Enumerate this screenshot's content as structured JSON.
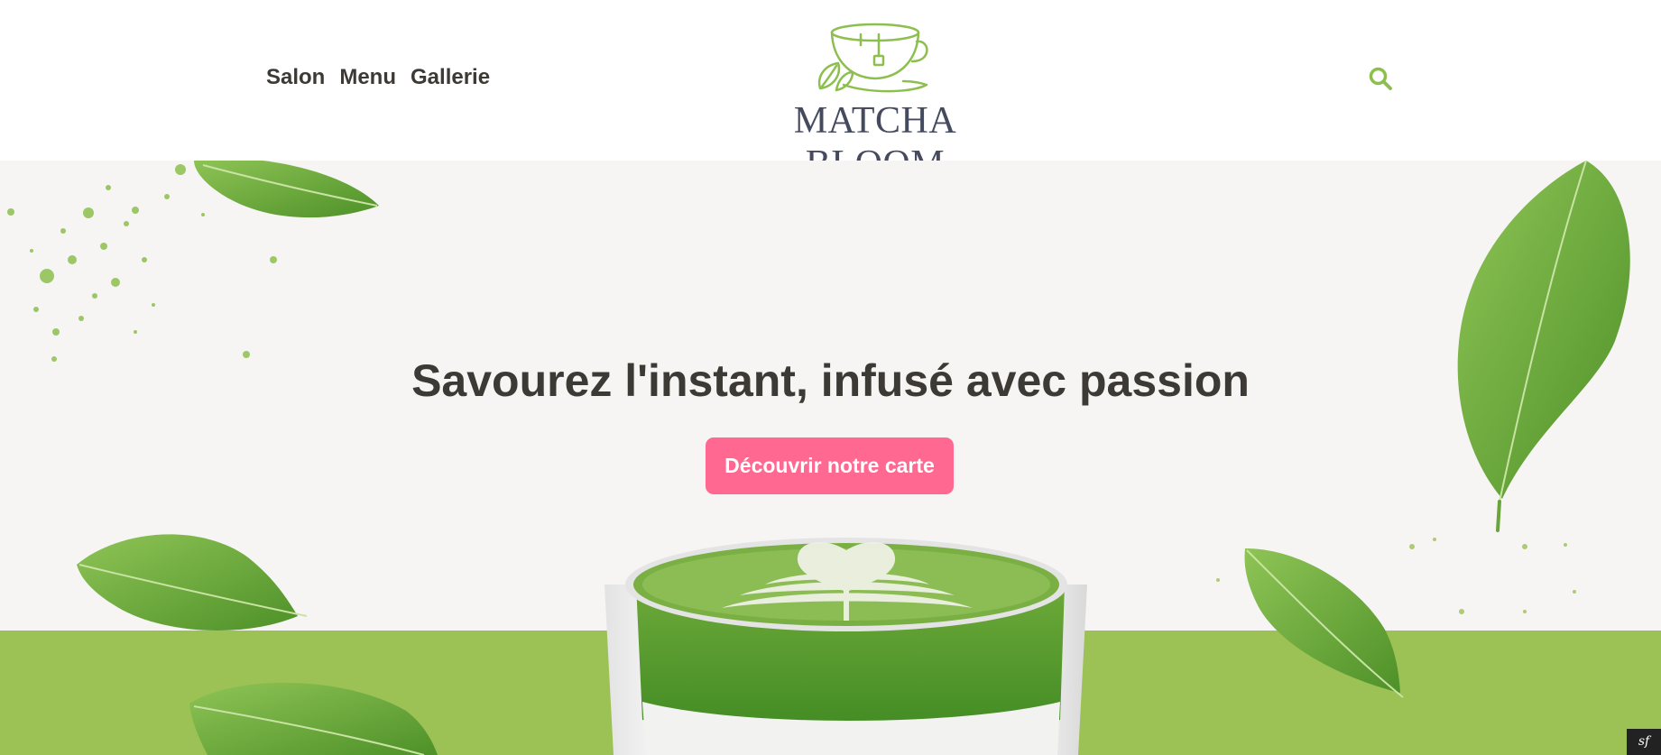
{
  "nav": {
    "items": [
      {
        "label": "Salon"
      },
      {
        "label": "Menu"
      },
      {
        "label": "Gallerie"
      }
    ]
  },
  "brand": {
    "name": "MATCHA BLOOM",
    "logo_icon": "teacup-leaves-icon"
  },
  "header": {
    "search_icon": "search-icon"
  },
  "hero": {
    "title": "Savourez l'instant, infusé avec passion",
    "cta_label": "Découvrir notre carte"
  },
  "colors": {
    "accent_green": "#9cc155",
    "logo_green": "#8dbf4f",
    "cta_pink": "#ff6891",
    "text_dark": "#3d3a36",
    "hero_bg": "#f6f5f3",
    "brand_navy": "#454a5e"
  },
  "debug_toolbar": {
    "icon": "symfony-icon"
  }
}
